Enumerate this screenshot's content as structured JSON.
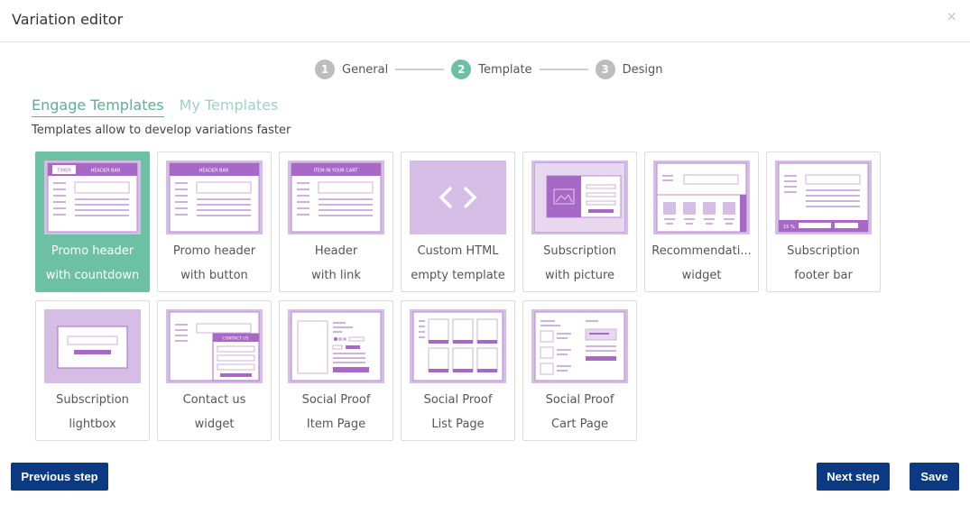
{
  "header": {
    "title": "Variation editor",
    "close_label": "×"
  },
  "stepper": [
    {
      "num": "1",
      "label": "General"
    },
    {
      "num": "2",
      "label": "Template"
    },
    {
      "num": "3",
      "label": "Design"
    }
  ],
  "tabs": [
    {
      "label": "Engage Templates"
    },
    {
      "label": "My Templates"
    }
  ],
  "subtitle": "Templates allow to develop variations faster",
  "thumb_text": {
    "timer": "TIMER",
    "header_bar": "HEADER BAR",
    "item_in_cart": "ITEM IN YOUR CART",
    "contact_us": "CONTACT US",
    "percent": "15 %",
    "vertical": "RECOMMENDATIONS"
  },
  "templates": [
    {
      "line1": "Promo header",
      "line2": "with countdown"
    },
    {
      "line1": "Promo header",
      "line2": "with button"
    },
    {
      "line1": "Header",
      "line2": "with link"
    },
    {
      "line1": "Custom HTML",
      "line2": "empty template"
    },
    {
      "line1": "Subscription",
      "line2": "with picture"
    },
    {
      "line1": "Recommendati...",
      "line2": "widget"
    },
    {
      "line1": "Subscription",
      "line2": "footer bar"
    },
    {
      "line1": "Subscription",
      "line2": "lightbox"
    },
    {
      "line1": "Contact us",
      "line2": "widget"
    },
    {
      "line1": "Social Proof",
      "line2": "Item Page"
    },
    {
      "line1": "Social Proof",
      "line2": "List Page"
    },
    {
      "line1": "Social Proof",
      "line2": "Cart Page"
    }
  ],
  "footer": {
    "previous_label": "Previous step",
    "next_label": "Next step",
    "save_label": "Save"
  },
  "colors": {
    "selected": "#6cc0a4",
    "thumb_bg": "#d6bde6",
    "accent_purple": "#a869c6",
    "button": "#0c3a82"
  }
}
